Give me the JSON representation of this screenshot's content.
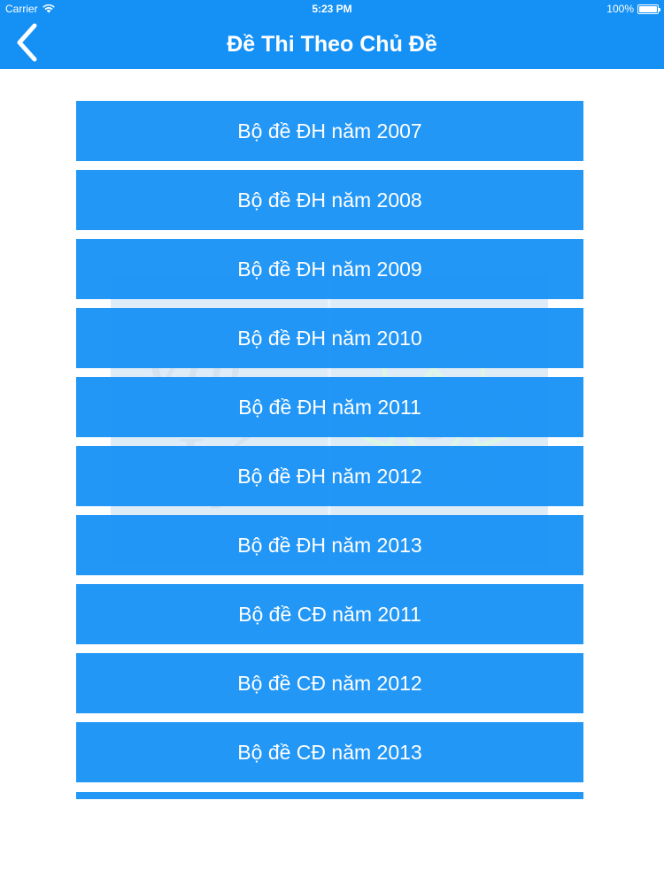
{
  "status_bar": {
    "carrier": "Carrier",
    "time": "5:23 PM",
    "battery": "100%",
    "battery_level": 1.0
  },
  "header": {
    "title": "Đề Thi Theo Chủ Đề",
    "back_icon": "chevron-left-icon"
  },
  "colors": {
    "accent": "#1591f5",
    "background": "#ffffff",
    "text_on_accent": "#ffffff"
  },
  "list": {
    "items": [
      {
        "label": "Bộ đề ĐH năm 2007"
      },
      {
        "label": "Bộ đề ĐH năm 2008"
      },
      {
        "label": "Bộ đề ĐH năm 2009"
      },
      {
        "label": "Bộ đề ĐH năm 2010"
      },
      {
        "label": "Bộ đề ĐH năm 2011"
      },
      {
        "label": "Bộ đề ĐH năm 2012"
      },
      {
        "label": "Bộ đề ĐH năm 2013"
      },
      {
        "label": "Bộ đề CĐ năm 2011"
      },
      {
        "label": "Bộ đề CĐ năm 2012"
      },
      {
        "label": "Bộ đề CĐ năm 2013"
      }
    ]
  },
  "watermark": {
    "text_line1": "Vật",
    "text_line2": "Lý",
    "icon": "atom-icon"
  }
}
